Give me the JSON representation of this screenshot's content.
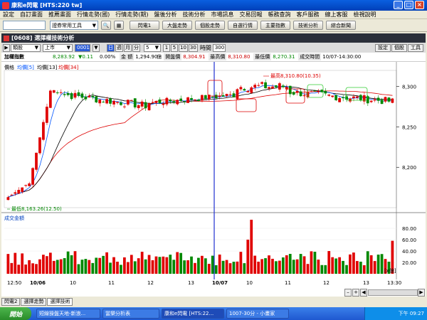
{
  "window": {
    "title": "康和e閃電 [HTS:220 tw]"
  },
  "menu": [
    "設定",
    "自訂畫面",
    "推薦畫面",
    "行情走勢(國)",
    "行情走勢(期)",
    "盤後分析",
    "技術分析",
    "市場訊息",
    "交易回報",
    "帳務查詢",
    "客戶服務",
    "線上客服",
    "檢視說明"
  ],
  "toolbar": {
    "combo_value": "證券常用工具",
    "buttons": [
      "閃電1",
      "大盤走勢",
      "個股走勢",
      "自選行情",
      "主要指數",
      "技術分析",
      "綜合新聞"
    ]
  },
  "panel": {
    "title": "[0608] 選擇權技術分析"
  },
  "controls": {
    "category": "類股",
    "market": "上市",
    "code": "0001",
    "periods": [
      "日",
      "週",
      "月",
      "分"
    ],
    "minute": "5",
    "ranges": [
      "1",
      "5",
      "10",
      "30"
    ],
    "label_count": "時間",
    "count": "300",
    "right_buttons": [
      "設定",
      "個股",
      "工具"
    ]
  },
  "info": {
    "name": "加權指數",
    "price": "8,283.92",
    "change": "▼0.11",
    "pct": "0.00%",
    "vol_label": "金 額",
    "vol": "1,294.90",
    "vol_unit": "億",
    "open_label": "開盤價",
    "open": "8,304.91",
    "high_label": "最高價",
    "high": "8,310.80",
    "low_label": "最低價",
    "low": "8,270.31",
    "time_label": "成交時間",
    "time": "10/07-14:30:00"
  },
  "chart": {
    "legend_price": "價格",
    "legend_ma5": "均價[5]",
    "legend_ma13": "均價[13]",
    "legend_ma34": "均價[34]",
    "high_annotation": "最高8,310.80(10.35)",
    "low_annotation": "最低8,163.26(12.50)",
    "vol_title": "成交金額",
    "vol_unit": "[x億]",
    "price_ticks": [
      "8,300",
      "8,250",
      "8,200"
    ],
    "vol_ticks": [
      "80.00",
      "60.00",
      "40.00",
      "20.00"
    ],
    "x_labels": [
      "12:50",
      "10/06",
      "10",
      "11",
      "12",
      "13",
      "10/07",
      "10",
      "11",
      "12",
      "13",
      "13:30"
    ]
  },
  "tabs": [
    "閃電2",
    "選擇走勢",
    "選擇技術"
  ],
  "taskbar": {
    "start": "開始",
    "tasks": [
      "短線操盤天地-新浪...",
      "當樂分析表",
      "康和e閃電 [HTS:22...",
      "1007-30分 - 小畫家"
    ],
    "clock": "下午 09:27"
  },
  "chart_data": {
    "type": "candlestick",
    "ma_periods": [
      5,
      13,
      34
    ],
    "ylim": [
      8150,
      8320
    ],
    "volume_ylim": [
      0,
      100
    ]
  }
}
